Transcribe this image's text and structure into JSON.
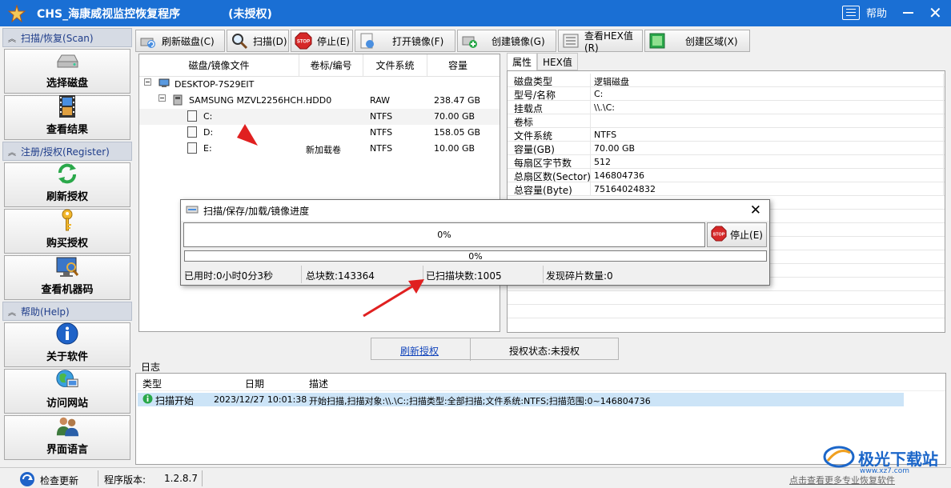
{
  "window": {
    "title": "CHS_海康威视监控恢复程序",
    "license_tag": "(未授权)",
    "help_label": "帮助"
  },
  "sidebar": {
    "sections": [
      {
        "label": "扫描/恢复(Scan)",
        "items": [
          {
            "label": "选择磁盘",
            "icon": "disk-icon"
          },
          {
            "label": "查看结果",
            "icon": "film-icon"
          }
        ]
      },
      {
        "label": "注册/授权(Register)",
        "items": [
          {
            "label": "刷新授权",
            "icon": "refresh-icon"
          },
          {
            "label": "购买授权",
            "icon": "key-icon"
          },
          {
            "label": "查看机器码",
            "icon": "monitor-icon"
          }
        ]
      },
      {
        "label": "帮助(Help)",
        "items": [
          {
            "label": "关于软件",
            "icon": "info-icon"
          },
          {
            "label": "访问网站",
            "icon": "globe-icon"
          },
          {
            "label": "界面语言",
            "icon": "users-icon"
          }
        ]
      }
    ]
  },
  "toolbar": {
    "refresh": "刷新磁盘(C)",
    "scan": "扫描(D)",
    "stop": "停止(E)",
    "open_image": "打开镜像(F)",
    "create_image": "创建镜像(G)",
    "hex": "查看HEX值(R)",
    "create_region": "创建区域(X)"
  },
  "disk_table": {
    "headers": [
      "磁盘/镜像文件",
      "卷标/编号",
      "文件系统",
      "容量"
    ],
    "rows": [
      {
        "name": "DESKTOP-7S29EIT",
        "label": "",
        "fs": "",
        "size": ""
      },
      {
        "name": "SAMSUNG MZVL2256HCH…",
        "label": "HDD0",
        "fs": "RAW",
        "size": "238.47 GB"
      },
      {
        "name": "C:",
        "label": "",
        "fs": "NTFS",
        "size": "70.00 GB"
      },
      {
        "name": "D:",
        "label": "",
        "fs": "NTFS",
        "size": "158.05 GB"
      },
      {
        "name": "E:",
        "label": "新加载卷",
        "fs": "NTFS",
        "size": "10.00 GB"
      }
    ]
  },
  "properties": {
    "tabs": [
      "属性",
      "HEX值"
    ],
    "rows": [
      {
        "key": "磁盘类型",
        "value": "逻辑磁盘"
      },
      {
        "key": "型号/名称",
        "value": "C:"
      },
      {
        "key": "挂载点",
        "value": "\\\\.\\C:"
      },
      {
        "key": "卷标",
        "value": ""
      },
      {
        "key": "文件系统",
        "value": "NTFS"
      },
      {
        "key": "容量(GB)",
        "value": "70.00 GB"
      },
      {
        "key": "每扇区字节数",
        "value": "512"
      },
      {
        "key": "总扇区数(Sector)",
        "value": "146804736"
      },
      {
        "key": "总容量(Byte)",
        "value": "75164024832"
      }
    ]
  },
  "dialog": {
    "title": "扫描/保存/加载/镜像进度",
    "progress_main": "0%",
    "progress_sub": "0%",
    "stop_label": "停止(E)",
    "elapsed": "已用时:0小时0分3秒",
    "total_blocks": "总块数:143364",
    "scanned_blocks": "已扫描块数:1005",
    "fragments": "发现碎片数量:0",
    "progress": 0
  },
  "auth": {
    "refresh_link": "刷新授权",
    "status": "授权状态:未授权"
  },
  "log": {
    "label": "日志",
    "headers": [
      "类型",
      "日期",
      "描述"
    ],
    "rows": [
      {
        "type": "扫描开始",
        "date": "2023/12/27 10:01:38",
        "desc": "开始扫描,扫描对象:\\\\.\\C:;扫描类型:全部扫描;文件系统:NTFS;扫描范围:0~146804736"
      }
    ]
  },
  "statusbar": {
    "check_update": "检查更新",
    "version_label": "程序版本:",
    "version": "1.2.8.7",
    "hint": "点击查看更多专业恢复软件"
  },
  "watermark": {
    "title": "极光下载站",
    "url": "www.xz7.com"
  },
  "colors": {
    "titlebar": "#1a6fd4",
    "selection": "#cce4f7",
    "arrow": "#e02020"
  }
}
